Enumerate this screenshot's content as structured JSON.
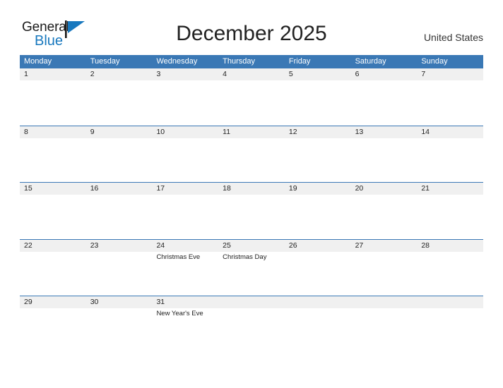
{
  "brand": {
    "name_part1": "General",
    "name_part2": "Blue",
    "flag_icon": "flag-triangle-icon",
    "accent_color": "#1878be"
  },
  "header": {
    "title": "December 2025",
    "country": "United States"
  },
  "colors": {
    "header_blue": "#3a78b5",
    "row_band_gray": "#f0f0f0",
    "text": "#222222"
  },
  "calendar": {
    "weekday_headers": [
      "Monday",
      "Tuesday",
      "Wednesday",
      "Thursday",
      "Friday",
      "Saturday",
      "Sunday"
    ],
    "weeks": [
      {
        "days": [
          {
            "num": "1",
            "events": []
          },
          {
            "num": "2",
            "events": []
          },
          {
            "num": "3",
            "events": []
          },
          {
            "num": "4",
            "events": []
          },
          {
            "num": "5",
            "events": []
          },
          {
            "num": "6",
            "events": []
          },
          {
            "num": "7",
            "events": []
          }
        ]
      },
      {
        "days": [
          {
            "num": "8",
            "events": []
          },
          {
            "num": "9",
            "events": []
          },
          {
            "num": "10",
            "events": []
          },
          {
            "num": "11",
            "events": []
          },
          {
            "num": "12",
            "events": []
          },
          {
            "num": "13",
            "events": []
          },
          {
            "num": "14",
            "events": []
          }
        ]
      },
      {
        "days": [
          {
            "num": "15",
            "events": []
          },
          {
            "num": "16",
            "events": []
          },
          {
            "num": "17",
            "events": []
          },
          {
            "num": "18",
            "events": []
          },
          {
            "num": "19",
            "events": []
          },
          {
            "num": "20",
            "events": []
          },
          {
            "num": "21",
            "events": []
          }
        ]
      },
      {
        "days": [
          {
            "num": "22",
            "events": []
          },
          {
            "num": "23",
            "events": []
          },
          {
            "num": "24",
            "events": [
              "Christmas Eve"
            ]
          },
          {
            "num": "25",
            "events": [
              "Christmas Day"
            ]
          },
          {
            "num": "26",
            "events": []
          },
          {
            "num": "27",
            "events": []
          },
          {
            "num": "28",
            "events": []
          }
        ]
      },
      {
        "days": [
          {
            "num": "29",
            "events": []
          },
          {
            "num": "30",
            "events": []
          },
          {
            "num": "31",
            "events": [
              "New Year's Eve"
            ]
          },
          {
            "num": "",
            "events": []
          },
          {
            "num": "",
            "events": []
          },
          {
            "num": "",
            "events": []
          },
          {
            "num": "",
            "events": []
          }
        ]
      }
    ]
  }
}
